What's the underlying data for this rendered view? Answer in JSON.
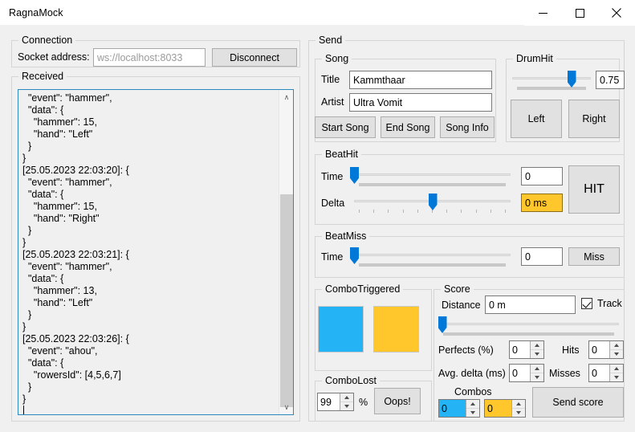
{
  "window": {
    "title": "RagnaMock",
    "minimize_label": "Minimize",
    "maximize_label": "Maximize",
    "close_label": "Close"
  },
  "connection": {
    "legend": "Connection",
    "socket_label": "Socket address:",
    "socket_placeholder": "ws://localhost:8033",
    "socket_value": "",
    "disconnect_label": "Disconnect"
  },
  "received": {
    "legend": "Received",
    "log": "  \"event\": \"hammer\",\n  \"data\": {\n    \"hammer\": 15,\n    \"hand\": \"Left\"\n  }\n}\n[25.05.2023 22:03:20]: {\n  \"event\": \"hammer\",\n  \"data\": {\n    \"hammer\": 15,\n    \"hand\": \"Right\"\n  }\n}\n[25.05.2023 22:03:21]: {\n  \"event\": \"hammer\",\n  \"data\": {\n    \"hammer\": 13,\n    \"hand\": \"Left\"\n  }\n}\n[25.05.2023 22:03:26]: {\n  \"event\": \"ahou\",\n  \"data\": {\n    \"rowersId\": [4,5,6,7]\n  }\n}",
    "scroll_up_glyph": "∧",
    "scroll_down_glyph": "∨"
  },
  "send": {
    "legend": "Send"
  },
  "song": {
    "legend": "Song",
    "title_label": "Title",
    "title_value": "Kammthaar",
    "artist_label": "Artist",
    "artist_value": "Ultra Vomit",
    "start_label": "Start Song",
    "end_label": "End Song",
    "info_label": "Song Info"
  },
  "drumhit": {
    "legend": "DrumHit",
    "value": "0.75",
    "slider_percent": 75,
    "left_label": "Left",
    "right_label": "Right"
  },
  "beathit": {
    "legend": "BeatHit",
    "time_label": "Time",
    "time_value": "0",
    "time_percent": 0,
    "delta_label": "Delta",
    "delta_value": "0 ms",
    "delta_percent": 50,
    "hit_label": "HIT"
  },
  "beatmiss": {
    "legend": "BeatMiss",
    "time_label": "Time",
    "time_value": "0",
    "time_percent": 0,
    "miss_label": "Miss"
  },
  "combotriggered": {
    "legend": "ComboTriggered",
    "blue_color": "#24b4f5",
    "yellow_color": "#ffc72c"
  },
  "combolost": {
    "legend": "ComboLost",
    "percent_value": "99",
    "percent_symbol": "%",
    "oops_label": "Oops!"
  },
  "score": {
    "legend": "Score",
    "distance_label": "Distance",
    "distance_value": "0 m",
    "distance_percent": 2,
    "track_label": "Track",
    "track_checked": true,
    "perfects_label": "Perfects (%)",
    "perfects_value": "0",
    "hits_label": "Hits",
    "hits_value": "0",
    "avg_delta_label": "Avg. delta (ms)",
    "avg_delta_value": "0",
    "misses_label": "Misses",
    "misses_value": "0",
    "combos_label": "Combos",
    "combo_blue_value": "0",
    "combo_yellow_value": "0",
    "send_score_label": "Send score"
  }
}
